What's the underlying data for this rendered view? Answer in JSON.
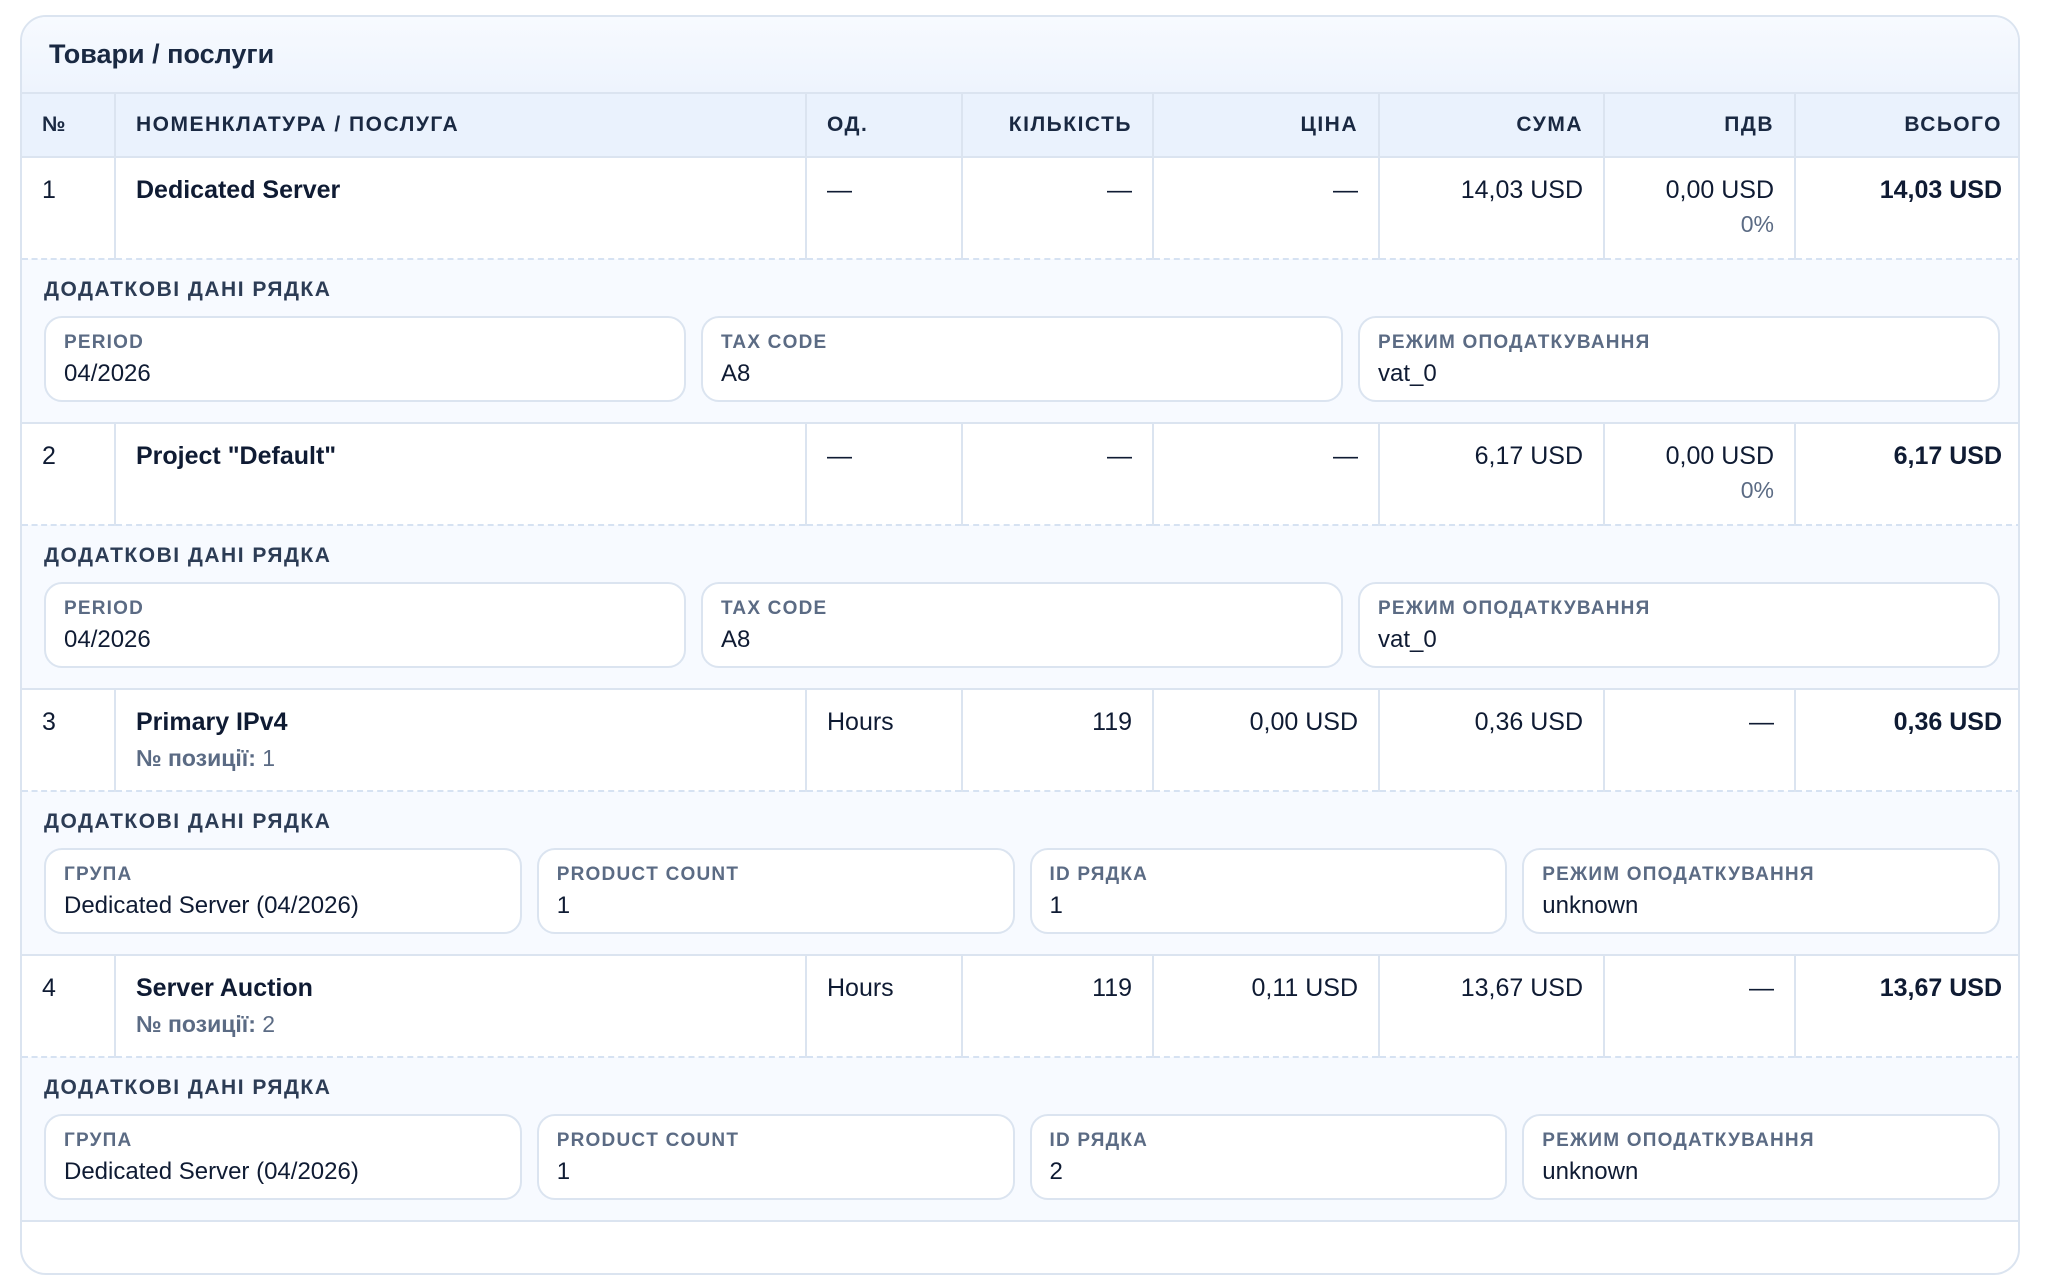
{
  "section_title": "Товари / послуги",
  "columns": {
    "num": "№",
    "name": "Номенклатура / послуга",
    "unit": "Од.",
    "qty": "Кількість",
    "price": "Ціна",
    "sum": "Сума",
    "vat": "ПДВ",
    "total": "Всього"
  },
  "extra_title": "Додаткові дані рядка",
  "position_label": "№ позиції:",
  "rows": [
    {
      "num": "1",
      "name": "Dedicated Server",
      "position": "",
      "unit": "—",
      "qty": "—",
      "price": "—",
      "sum": "14,03 USD",
      "vat": "0,00 USD",
      "vat_pct": "0%",
      "total": "14,03 USD",
      "extra": [
        {
          "label": "Period",
          "value": "04/2026"
        },
        {
          "label": "Tax code",
          "value": "A8"
        },
        {
          "label": "Режим оподаткування",
          "value": "vat_0"
        }
      ]
    },
    {
      "num": "2",
      "name": "Project \"Default\"",
      "position": "",
      "unit": "—",
      "qty": "—",
      "price": "—",
      "sum": "6,17 USD",
      "vat": "0,00 USD",
      "vat_pct": "0%",
      "total": "6,17 USD",
      "extra": [
        {
          "label": "Period",
          "value": "04/2026"
        },
        {
          "label": "Tax code",
          "value": "A8"
        },
        {
          "label": "Режим оподаткування",
          "value": "vat_0"
        }
      ]
    },
    {
      "num": "3",
      "name": "Primary IPv4",
      "position": "1",
      "unit": "Hours",
      "qty": "119",
      "price": "0,00 USD",
      "sum": "0,36 USD",
      "vat": "—",
      "vat_pct": "",
      "total": "0,36 USD",
      "extra": [
        {
          "label": "Група",
          "value": "Dedicated Server (04/2026)"
        },
        {
          "label": "Product count",
          "value": "1"
        },
        {
          "label": "ID рядка",
          "value": "1"
        },
        {
          "label": "Режим оподаткування",
          "value": "unknown"
        }
      ]
    },
    {
      "num": "4",
      "name": "Server Auction",
      "position": "2",
      "unit": "Hours",
      "qty": "119",
      "price": "0,11 USD",
      "sum": "13,67 USD",
      "vat": "—",
      "vat_pct": "",
      "total": "13,67 USD",
      "extra": [
        {
          "label": "Група",
          "value": "Dedicated Server (04/2026)"
        },
        {
          "label": "Product count",
          "value": "1"
        },
        {
          "label": "ID рядка",
          "value": "2"
        },
        {
          "label": "Режим оподаткування",
          "value": "unknown"
        }
      ]
    }
  ]
}
